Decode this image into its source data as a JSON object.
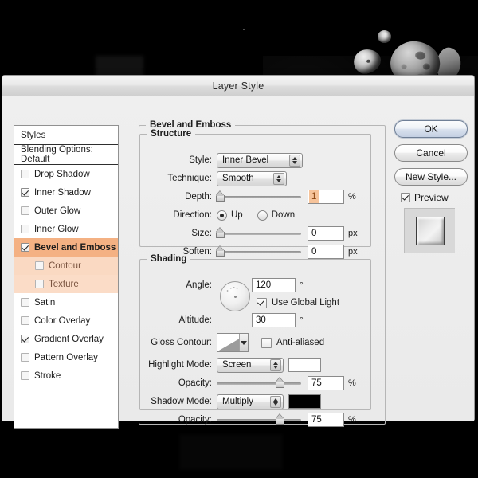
{
  "window": {
    "title": "Layer Style"
  },
  "styles_panel": {
    "header": "Styles",
    "blending_options": "Blending Options: Default",
    "effects": [
      {
        "label": "Drop Shadow",
        "checked": false,
        "selected": false,
        "sub": false
      },
      {
        "label": "Inner Shadow",
        "checked": true,
        "selected": false,
        "sub": false
      },
      {
        "label": "Outer Glow",
        "checked": false,
        "selected": false,
        "sub": false
      },
      {
        "label": "Inner Glow",
        "checked": false,
        "selected": false,
        "sub": false
      },
      {
        "label": "Bevel and Emboss",
        "checked": true,
        "selected": true,
        "sub": false
      },
      {
        "label": "Contour",
        "checked": false,
        "selected": false,
        "sub": true
      },
      {
        "label": "Texture",
        "checked": false,
        "selected": false,
        "sub": true
      },
      {
        "label": "Satin",
        "checked": false,
        "selected": false,
        "sub": false
      },
      {
        "label": "Color Overlay",
        "checked": false,
        "selected": false,
        "sub": false
      },
      {
        "label": "Gradient Overlay",
        "checked": true,
        "selected": false,
        "sub": false
      },
      {
        "label": "Pattern Overlay",
        "checked": false,
        "selected": false,
        "sub": false
      },
      {
        "label": "Stroke",
        "checked": false,
        "selected": false,
        "sub": false
      }
    ]
  },
  "panel": {
    "title": "Bevel and Emboss",
    "structure": {
      "legend": "Structure",
      "style_label": "Style:",
      "style_value": "Inner Bevel",
      "technique_label": "Technique:",
      "technique_value": "Smooth",
      "depth_label": "Depth:",
      "depth_value": "1",
      "depth_unit": "%",
      "direction_label": "Direction:",
      "direction_up": "Up",
      "direction_down": "Down",
      "direction_selected": "Up",
      "size_label": "Size:",
      "size_value": "0",
      "size_unit": "px",
      "soften_label": "Soften:",
      "soften_value": "0",
      "soften_unit": "px"
    },
    "shading": {
      "legend": "Shading",
      "angle_label": "Angle:",
      "angle_value": "120",
      "angle_unit": "°",
      "use_global_light_label": "Use Global Light",
      "use_global_light_checked": true,
      "altitude_label": "Altitude:",
      "altitude_value": "30",
      "altitude_unit": "°",
      "gloss_contour_label": "Gloss Contour:",
      "anti_aliased_label": "Anti-aliased",
      "anti_aliased_checked": false,
      "highlight_mode_label": "Highlight Mode:",
      "highlight_mode_value": "Screen",
      "highlight_color": "#ffffff",
      "highlight_opacity_label": "Opacity:",
      "highlight_opacity_value": "75",
      "highlight_opacity_unit": "%",
      "shadow_mode_label": "Shadow Mode:",
      "shadow_mode_value": "Multiply",
      "shadow_color": "#000000",
      "shadow_opacity_label": "Opacity:",
      "shadow_opacity_value": "75",
      "shadow_opacity_unit": "%"
    }
  },
  "buttons": {
    "ok": "OK",
    "cancel": "Cancel",
    "new_style": "New Style...",
    "preview_label": "Preview",
    "preview_checked": true
  },
  "colors": {
    "selected_row": "#f4b183",
    "sub_row": "#fad9c2",
    "field_selection": "#f6c39a",
    "dialog_bg": "#ececec"
  }
}
